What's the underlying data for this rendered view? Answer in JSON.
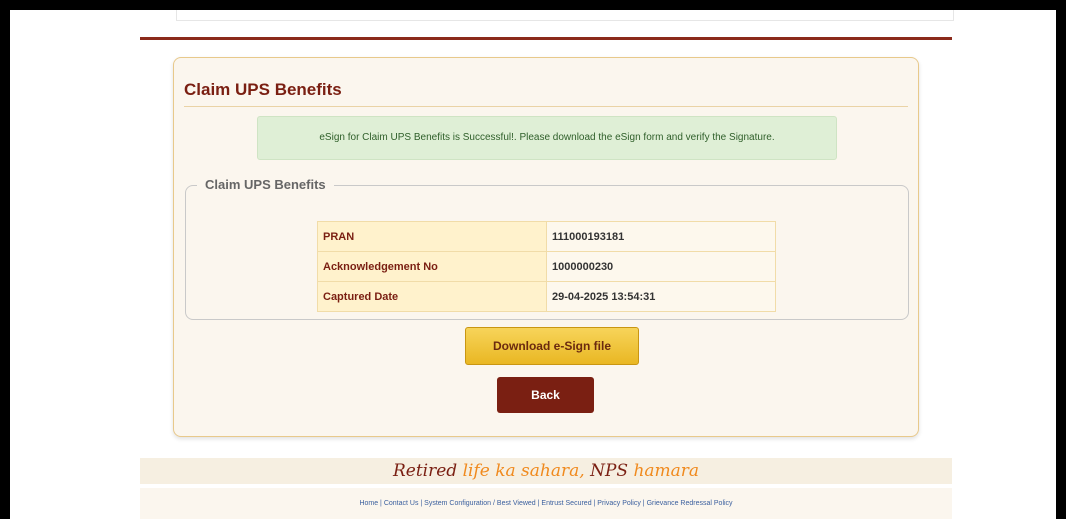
{
  "card": {
    "title": "Claim UPS Benefits",
    "alert_message": "eSign for Claim UPS Benefits is Successful!. Please download the eSign form and verify the Signature.",
    "fieldset_legend": "Claim UPS Benefits",
    "rows": [
      {
        "label": "PRAN",
        "value": "111000193181"
      },
      {
        "label": "Acknowledgement No",
        "value": "1000000230"
      },
      {
        "label": "Captured Date",
        "value": "29-04-2025 13:54:31"
      }
    ],
    "download_button": "Download e-Sign file",
    "back_button": "Back"
  },
  "tagline": {
    "retired": "Retired",
    "life_ka_sahara": "life ka sahara,",
    "nps": "NPS",
    "hamara": "hamara"
  },
  "footer": {
    "links_text": "Home | Contact Us | System Configuration / Best Viewed | Entrust Secured | Privacy Policy | Grievance Redressal Policy"
  },
  "colors": {
    "brand_maroon": "#7a1f12",
    "accent_gold": "#e9b723",
    "success_green_bg": "#dfefd6"
  }
}
